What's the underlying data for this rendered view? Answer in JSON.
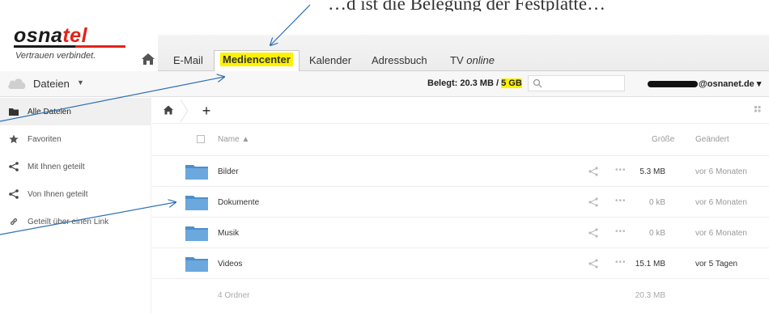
{
  "annotation_text": "…d ist die Belegung der Festplatte…",
  "brand": {
    "name_part1": "osna",
    "name_part2": "tel",
    "slogan": "Vertrauen verbindet."
  },
  "tabs": [
    {
      "label": "E-Mail"
    },
    {
      "label": "Mediencenter",
      "active": true
    },
    {
      "label": "Kalender"
    },
    {
      "label": "Adressbuch"
    },
    {
      "label_prefix": "TV",
      "label_suffix": "online"
    }
  ],
  "app": {
    "title": "Dateien",
    "quota_prefix": "Belegt: 20.3 MB /",
    "quota_total": "5 GB",
    "search_placeholder": "",
    "account_domain": "@osnanet.de",
    "account_caret": "▾"
  },
  "sidebar": {
    "items": [
      {
        "label": "Alle Dateien",
        "icon": "folder-icon",
        "active": true
      },
      {
        "label": "Favoriten",
        "icon": "star-icon"
      },
      {
        "label": "Mit Ihnen geteilt",
        "icon": "share-icon"
      },
      {
        "label": "Von Ihnen geteilt",
        "icon": "share-icon"
      },
      {
        "label": "Geteilt über einen Link",
        "icon": "link-icon"
      }
    ]
  },
  "toolbar": {
    "new_label": "+"
  },
  "list": {
    "columns": {
      "name": "Name ▲",
      "size": "Größe",
      "changed": "Geändert"
    },
    "rows": [
      {
        "name": "Bilder",
        "size": "5.3 MB",
        "changed": "vor 6 Monaten"
      },
      {
        "name": "Dokumente",
        "size": "0 kB",
        "changed": "vor 6 Monaten"
      },
      {
        "name": "Musik",
        "size": "0 kB",
        "changed": "vor 6 Monaten"
      },
      {
        "name": "Videos",
        "size": "15.1 MB",
        "changed": "vor 5 Tagen"
      }
    ],
    "summary": {
      "count": "4 Ordner",
      "size": "20.3 MB"
    }
  },
  "colors": {
    "highlight": "#fff200",
    "arrow": "#2f6fb6",
    "brand_red": "#e2231a",
    "folder": "#5b9bd5"
  }
}
